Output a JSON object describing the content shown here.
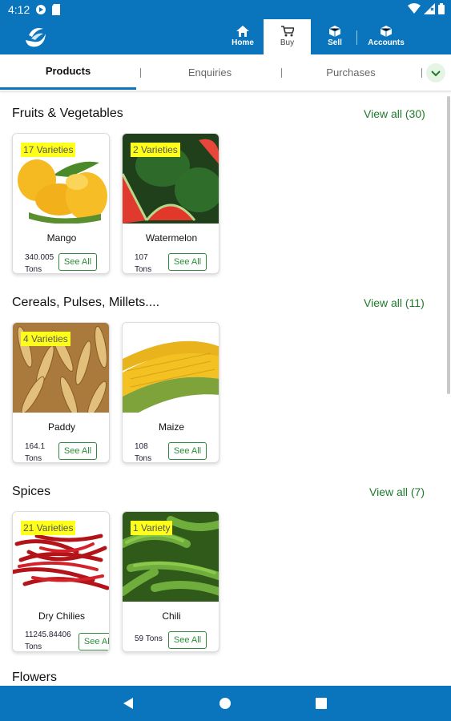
{
  "status_bar": {
    "time": "4:12"
  },
  "app_bar": {
    "nav": [
      {
        "label": "Home",
        "icon": "home-icon"
      },
      {
        "label": "Buy",
        "icon": "cart-icon"
      },
      {
        "label": "Sell",
        "icon": "box-icon"
      },
      {
        "label": "Accounts",
        "icon": "box-icon"
      }
    ],
    "active": "Buy"
  },
  "tabs": [
    {
      "label": "Products"
    },
    {
      "label": "Enquiries"
    },
    {
      "label": "Purchases"
    }
  ],
  "sections": [
    {
      "title": "Fruits & Vegetables",
      "view_all": "View all (30)",
      "items": [
        {
          "name": "Mango",
          "badge": "17 Varieties",
          "qty": "340.005\nTons",
          "see_all": "See All"
        },
        {
          "name": "Watermelon",
          "badge": "2 Varieties",
          "qty": "107\nTons",
          "see_all": "See All"
        }
      ]
    },
    {
      "title": "Cereals, Pulses, Millets....",
      "view_all": "View all (11)",
      "items": [
        {
          "name": "Paddy",
          "badge": "4 Varieties",
          "qty": "164.1\nTons",
          "see_all": "See All"
        },
        {
          "name": "Maize",
          "badge": "",
          "qty": "108\nTons",
          "see_all": "See All"
        }
      ]
    },
    {
      "title": "Spices",
      "view_all": "View all (7)",
      "items": [
        {
          "name": "Dry Chilies",
          "badge": "21 Varieties",
          "qty": "11245.84406\nTons",
          "see_all": "See All"
        },
        {
          "name": "Chili",
          "badge": "1 Variety",
          "qty": "59 Tons",
          "see_all": "See All"
        }
      ]
    },
    {
      "title": "Flowers",
      "view_all": "",
      "items": []
    }
  ],
  "colors": {
    "brand_blue": "#0a74bd",
    "accent_green": "#1e7a2a",
    "badge_yellow": "#ffff1a"
  }
}
